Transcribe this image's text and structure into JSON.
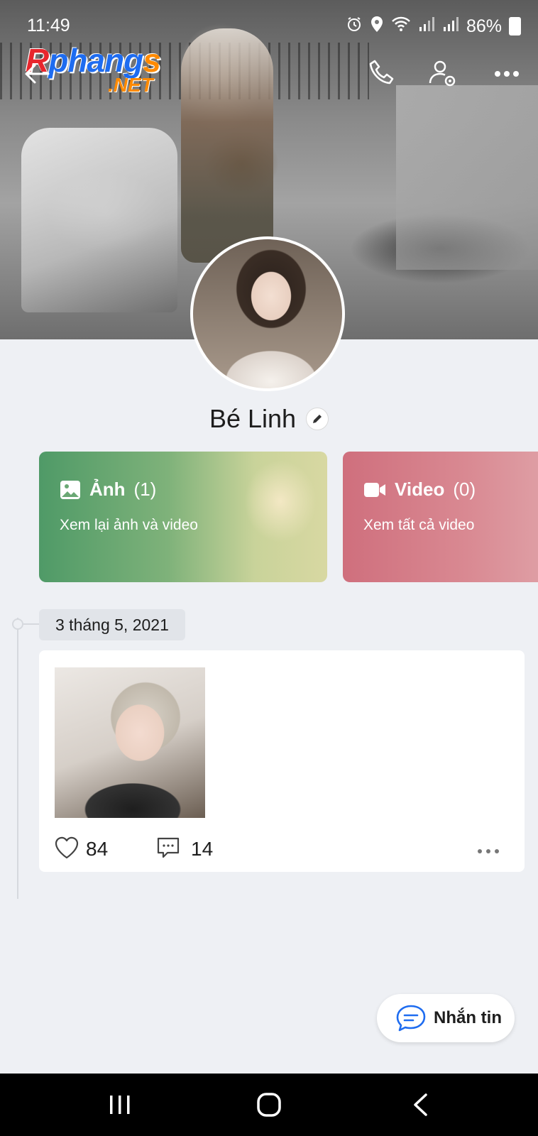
{
  "status_bar": {
    "time": "11:49",
    "battery": "86%",
    "icons": [
      "alarm-icon",
      "location-icon",
      "wifi-icon",
      "signal-icon",
      "signal-icon",
      "battery-icon"
    ]
  },
  "watermark": {
    "main_r": "R",
    "main_mid": "phang",
    "main_s": "s",
    "sub": ".NET"
  },
  "header": {
    "icons": [
      "back-arrow-icon",
      "phone-icon",
      "user-settings-icon",
      "more-icon"
    ]
  },
  "profile": {
    "name": "Bé Linh"
  },
  "albums": [
    {
      "title": "Ảnh",
      "count": "(1)",
      "subtitle": "Xem lại ảnh và video",
      "icon": "image-icon"
    },
    {
      "title": "Video",
      "count": "(0)",
      "subtitle": "Xem tất cả video",
      "icon": "video-camera-icon"
    }
  ],
  "timeline": {
    "date": "3 tháng 5, 2021"
  },
  "post": {
    "likes": "84",
    "comments": "14"
  },
  "message_button": {
    "label": "Nhắn tin"
  },
  "colors": {
    "background": "#eef0f4",
    "photos_card": "#4f9a67",
    "video_card": "#cf6f7d",
    "accent_blue": "#1e6cf0"
  }
}
